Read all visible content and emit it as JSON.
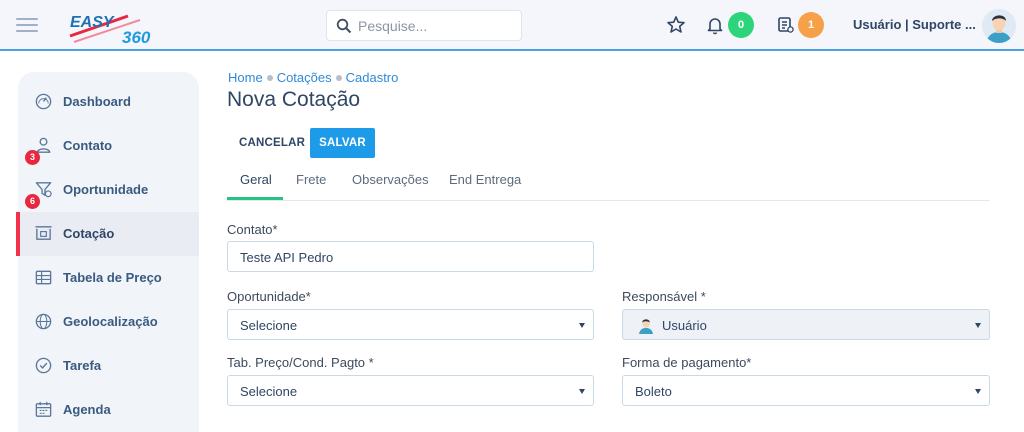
{
  "app": {
    "logo_text": "EASY360"
  },
  "search": {
    "placeholder": "Pesquise..."
  },
  "header": {
    "notifications_count": "0",
    "tasks_count": "1",
    "user_label": "Usuário | Suporte ...",
    "colors": {
      "accent": "#4aa3e0",
      "green_badge": "#2ed47a",
      "orange_badge": "#f7a04a"
    }
  },
  "sidebar": {
    "items": [
      {
        "label": "Dashboard",
        "icon": "dashboard-gauge-icon"
      },
      {
        "label": "Contato",
        "icon": "contact-person-icon",
        "badge": "3"
      },
      {
        "label": "Oportunidade",
        "icon": "opportunity-funnel-icon",
        "badge": "6"
      },
      {
        "label": "Cotação",
        "icon": "quote-icon",
        "active": true
      },
      {
        "label": "Tabela de Preço",
        "icon": "price-table-icon"
      },
      {
        "label": "Geolocalização",
        "icon": "globe-icon"
      },
      {
        "label": "Tarefa",
        "icon": "task-check-icon"
      },
      {
        "label": "Agenda",
        "icon": "calendar-icon"
      }
    ]
  },
  "breadcrumb": {
    "items": [
      "Home",
      "Cotações",
      "Cadastro"
    ]
  },
  "page": {
    "title": "Nova Cotação"
  },
  "actions": {
    "cancel": "CANCELAR",
    "save": "SALVAR"
  },
  "tabs": [
    "Geral",
    "Frete",
    "Observações",
    "End Entrega"
  ],
  "form": {
    "contato": {
      "label": "Contato*",
      "value": "Teste API Pedro"
    },
    "oportunidade": {
      "label": "Oportunidade*",
      "value": "Selecione"
    },
    "responsavel": {
      "label": "Responsável *",
      "value": "Usuário"
    },
    "tab_preco": {
      "label": "Tab. Preço/Cond. Pagto *",
      "value": "Selecione"
    },
    "forma_pagamento": {
      "label": "Forma de pagamento*",
      "value": "Boleto"
    }
  }
}
